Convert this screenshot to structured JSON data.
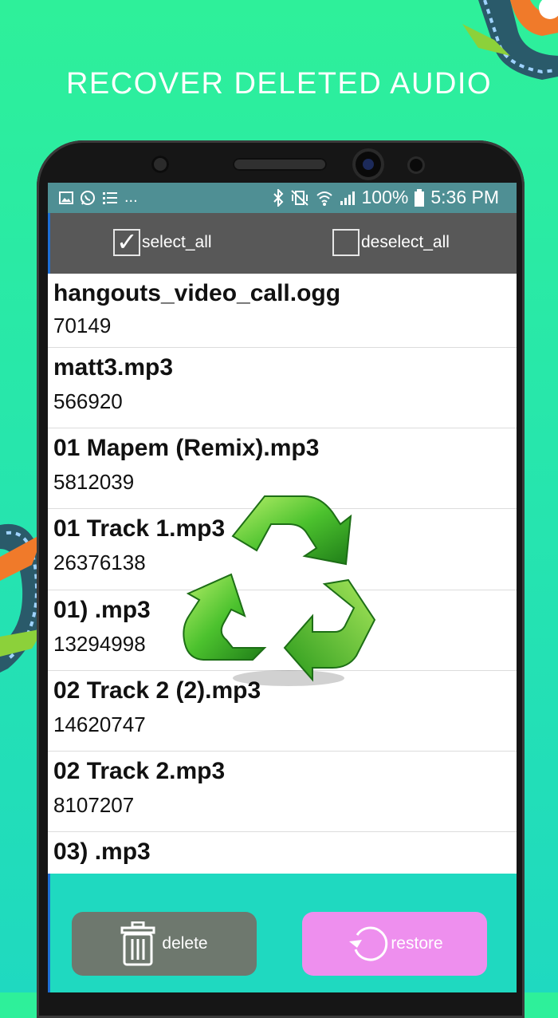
{
  "promo": {
    "title": "RECOVER DELETED AUDIO"
  },
  "status_bar": {
    "left_icons": [
      "image-icon",
      "whatsapp-icon",
      "list-icon"
    ],
    "left_more": "...",
    "battery": "100%",
    "time": "5:36 PM"
  },
  "toolbar": {
    "select_all": {
      "label": "select_all",
      "checked": true
    },
    "deselect_all": {
      "label": "deselect_all",
      "checked": false
    }
  },
  "files": [
    {
      "name": "hangouts_video_call.ogg",
      "size": "70149"
    },
    {
      "name": "matt3.mp3",
      "size": "566920"
    },
    {
      "name": "01 Mapem (Remix).mp3",
      "size": "5812039"
    },
    {
      "name": "01 Track 1.mp3",
      "size": "26376138"
    },
    {
      "name": "01) .mp3",
      "size": "13294998"
    },
    {
      "name": "02 Track 2 (2).mp3",
      "size": "14620747"
    },
    {
      "name": "02 Track 2.mp3",
      "size": "8107207"
    },
    {
      "name": "03) .mp3",
      "size": ""
    }
  ],
  "actions": {
    "delete_label": "delete",
    "restore_label": "restore"
  },
  "colors": {
    "background": "#27e6ac",
    "status_bar": "#4f8f94",
    "toolbar": "#585858",
    "delete_button": "#6e786e",
    "restore_button": "#ee8fee",
    "recycle": "#3dbb2a"
  }
}
